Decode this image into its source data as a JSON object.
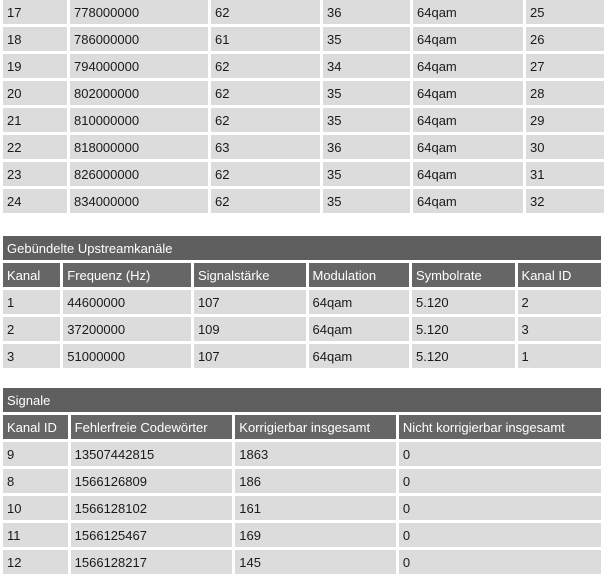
{
  "downstream": {
    "rows": [
      [
        "17",
        "778000000",
        "62",
        "36",
        "64qam",
        "25"
      ],
      [
        "18",
        "786000000",
        "61",
        "35",
        "64qam",
        "26"
      ],
      [
        "19",
        "794000000",
        "62",
        "34",
        "64qam",
        "27"
      ],
      [
        "20",
        "802000000",
        "62",
        "35",
        "64qam",
        "28"
      ],
      [
        "21",
        "810000000",
        "62",
        "35",
        "64qam",
        "29"
      ],
      [
        "22",
        "818000000",
        "63",
        "36",
        "64qam",
        "30"
      ],
      [
        "23",
        "826000000",
        "62",
        "35",
        "64qam",
        "31"
      ],
      [
        "24",
        "834000000",
        "62",
        "35",
        "64qam",
        "32"
      ]
    ]
  },
  "upstream": {
    "title": "Gebündelte Upstreamkanäle",
    "columns": [
      "Kanal",
      "Frequenz (Hz)",
      "Signalstärke",
      "Modulation",
      "Symbolrate",
      "Kanal ID"
    ],
    "rows": [
      [
        "1",
        "44600000",
        "107",
        "64qam",
        "5.120",
        "2"
      ],
      [
        "2",
        "37200000",
        "109",
        "64qam",
        "5.120",
        "3"
      ],
      [
        "3",
        "51000000",
        "107",
        "64qam",
        "5.120",
        "1"
      ]
    ]
  },
  "signals": {
    "title": "Signale",
    "columns": [
      "Kanal ID",
      "Fehlerfreie Codewörter",
      "Korrigierbar insgesamt",
      "Nicht korrigierbar insgesamt"
    ],
    "rows": [
      [
        "9",
        "13507442815",
        "1863",
        "0"
      ],
      [
        "8",
        "1566126809",
        "186",
        "0"
      ],
      [
        "10",
        "1566128102",
        "161",
        "0"
      ],
      [
        "11",
        "1566125467",
        "169",
        "0"
      ],
      [
        "12",
        "1566128217",
        "145",
        "0"
      ]
    ]
  }
}
